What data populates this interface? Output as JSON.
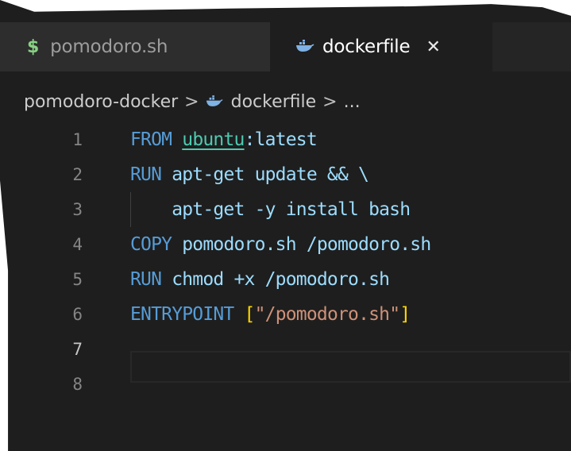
{
  "tabs": [
    {
      "icon": "shell-dollar-icon",
      "prefix": "$",
      "label": "pomodoro.sh",
      "active": false
    },
    {
      "icon": "docker-whale-icon",
      "label": "dockerfile",
      "close": "✕",
      "active": true
    }
  ],
  "breadcrumb": {
    "folder": "pomodoro-docker",
    "separator": ">",
    "file": "dockerfile",
    "more": "..."
  },
  "editor": {
    "active_line": "7",
    "lines": [
      {
        "number": "1",
        "parts": [
          "FROM",
          " ",
          "ubuntu",
          ":latest"
        ]
      },
      {
        "number": "2",
        "parts": [
          "RUN",
          " apt-get update && \\"
        ]
      },
      {
        "number": "3",
        "parts": [
          "    apt-get -y install bash"
        ]
      },
      {
        "number": "4",
        "parts": [
          "COPY",
          " pomodoro.sh /pomodoro.sh"
        ]
      },
      {
        "number": "5",
        "parts": [
          "RUN",
          " chmod +x /pomodoro.sh"
        ]
      },
      {
        "number": "6",
        "parts": [
          "ENTRYPOINT",
          " ",
          "[",
          "\"/pomodoro.sh\"",
          "]"
        ]
      },
      {
        "number": "7",
        "parts": [
          ""
        ]
      },
      {
        "number": "8",
        "parts": [
          ""
        ]
      }
    ]
  },
  "colors": {
    "background": "#1e1e1e",
    "keyword": "#569cd6",
    "argument": "#9cdcfe",
    "image_link": "#4ec9b0",
    "string": "#ce9178",
    "bracket": "#ffd700",
    "shell_icon": "#89d185",
    "docker_icon": "#7fb2e5"
  }
}
